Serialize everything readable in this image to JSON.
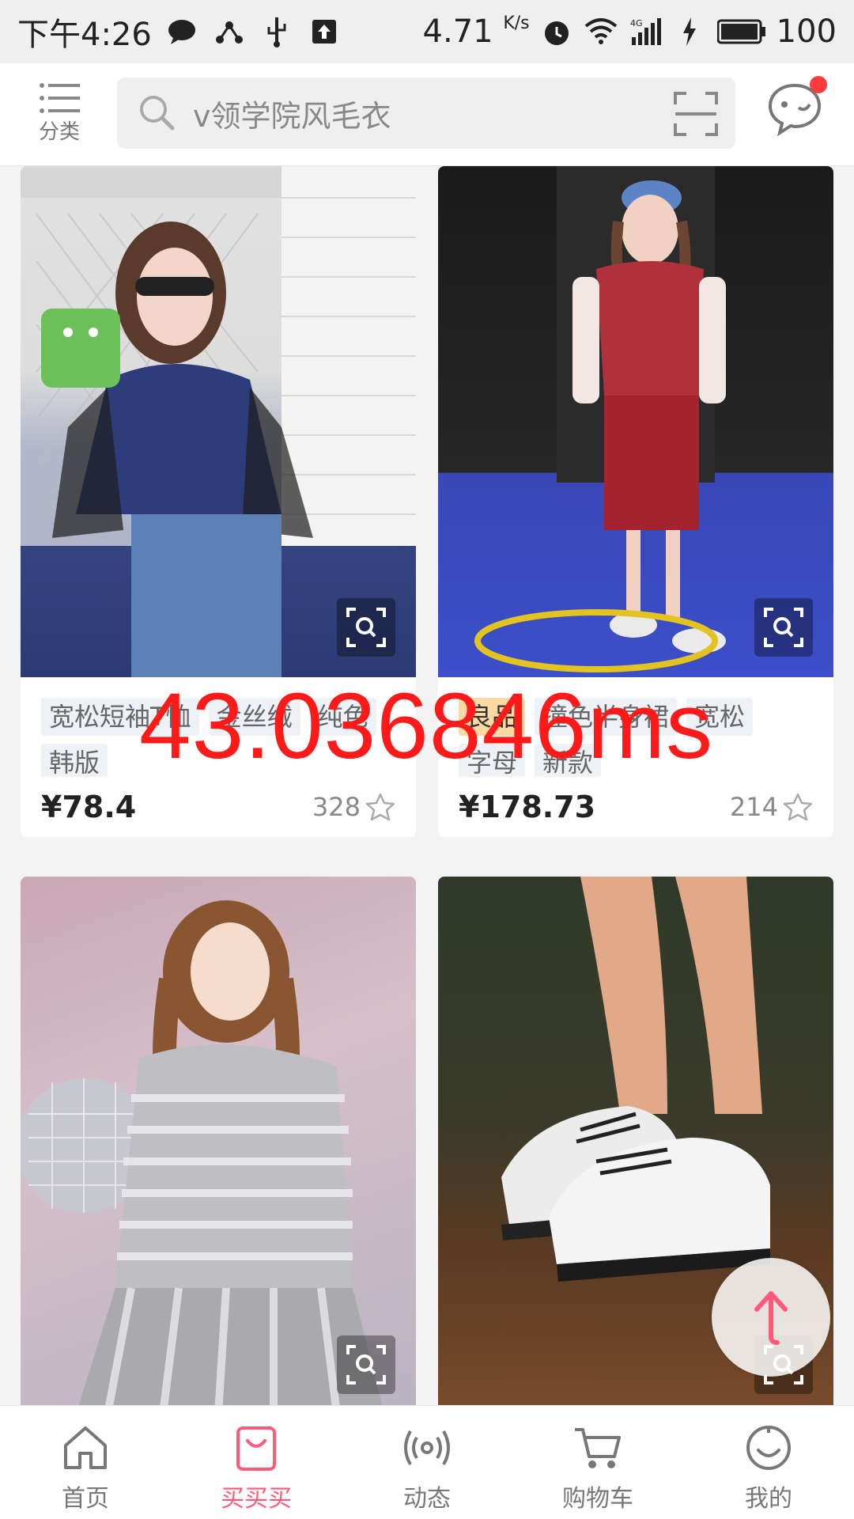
{
  "status_bar": {
    "time": "下午4:26",
    "net_speed": "4.71",
    "net_unit": "K/s",
    "battery": "100"
  },
  "header": {
    "category_label": "分类",
    "search_placeholder": "v领学院风毛衣"
  },
  "overlay": {
    "text": "43.036846ms"
  },
  "products": [
    {
      "tags": [
        {
          "text": "宽松短袖T恤",
          "hot": false
        },
        {
          "text": "金丝绒",
          "hot": false
        },
        {
          "text": "纯色",
          "hot": false
        },
        {
          "text": "韩版",
          "hot": false
        }
      ],
      "price": "¥78.4",
      "likes": "328"
    },
    {
      "tags": [
        {
          "text": "良品",
          "hot": true
        },
        {
          "text": "撞色半身裙",
          "hot": false
        },
        {
          "text": "宽松",
          "hot": false
        },
        {
          "text": "字母",
          "hot": false
        },
        {
          "text": "新款",
          "hot": false
        }
      ],
      "price": "¥178.73",
      "likes": "214"
    }
  ],
  "bottom_nav": [
    {
      "label": "首页",
      "icon": "home-icon",
      "active": false
    },
    {
      "label": "买买买",
      "icon": "shopping-bag-icon",
      "active": true
    },
    {
      "label": "动态",
      "icon": "broadcast-icon",
      "active": false
    },
    {
      "label": "购物车",
      "icon": "cart-icon",
      "active": false
    },
    {
      "label": "我的",
      "icon": "profile-icon",
      "active": false
    }
  ],
  "colors": {
    "accent": "#ff5a7a",
    "overlay_text": "#ff1a1a"
  }
}
